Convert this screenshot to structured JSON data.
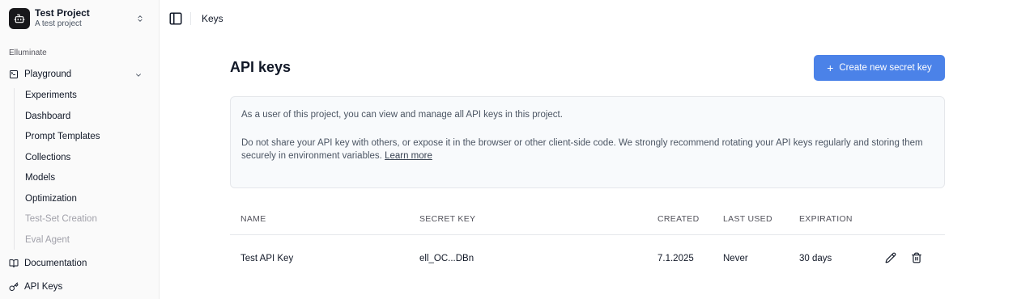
{
  "project": {
    "name": "Test Project",
    "description": "A test project"
  },
  "sidebar": {
    "section_label": "Elluminate",
    "playground_label": "Playground",
    "sub_items": [
      {
        "label": "Experiments",
        "disabled": false
      },
      {
        "label": "Dashboard",
        "disabled": false
      },
      {
        "label": "Prompt Templates",
        "disabled": false
      },
      {
        "label": "Collections",
        "disabled": false
      },
      {
        "label": "Models",
        "disabled": false
      },
      {
        "label": "Optimization",
        "disabled": false
      },
      {
        "label": "Test-Set Creation",
        "disabled": true
      },
      {
        "label": "Eval Agent",
        "disabled": true
      }
    ],
    "documentation_label": "Documentation",
    "api_keys_label": "API Keys"
  },
  "topbar": {
    "breadcrumb": "Keys"
  },
  "main": {
    "title": "API keys",
    "create_button_label": "Create new secret key",
    "info": {
      "line1": "As a user of this project, you can view and manage all API keys in this project.",
      "line2": "Do not share your API key with others, or expose it in the browser or other client-side code. We strongly recommend rotating your API keys regularly and storing them securely in environment variables.",
      "learn_more": "Learn more"
    },
    "table": {
      "columns": [
        "NAME",
        "SECRET KEY",
        "CREATED",
        "LAST USED",
        "EXPIRATION"
      ],
      "rows": [
        {
          "name": "Test API Key",
          "secret_key": "ell_OC...DBn",
          "created": "7.1.2025",
          "last_used": "Never",
          "expiration": "30 days"
        }
      ]
    }
  },
  "colors": {
    "accent": "#4b82e8",
    "sidebar_bg": "#fafafa",
    "info_bg": "#f8fafc"
  },
  "icons": [
    "bot-icon",
    "chevrons-up-down-icon",
    "terminal-icon",
    "chevron-down-icon",
    "book-icon",
    "key-icon",
    "sidebar-toggle-icon",
    "plus-icon",
    "pencil-icon",
    "trash-icon"
  ]
}
